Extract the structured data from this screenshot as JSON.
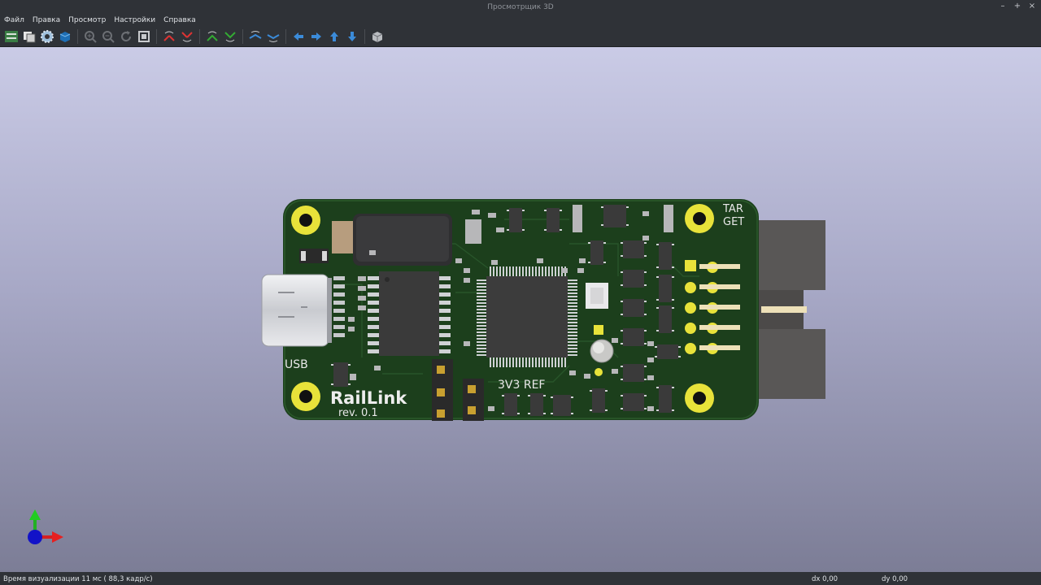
{
  "window": {
    "title": "Просмотрщик 3D"
  },
  "menu": [
    "Файл",
    "Правка",
    "Просмотр",
    "Настройки",
    "Справка"
  ],
  "toolbar_icons": [
    "reload-board-icon",
    "copy-image-icon",
    "raytrace-settings-icon",
    "render-mode-icon",
    "zoom-in-icon",
    "zoom-out-icon",
    "redraw-icon",
    "zoom-fit-icon",
    "rotate-x-cw-icon",
    "rotate-x-ccw-icon",
    "rotate-y-cw-icon",
    "rotate-y-ccw-icon",
    "rotate-z-cw-icon",
    "rotate-z-ccw-icon",
    "move-left-icon",
    "move-right-icon",
    "move-up-icon",
    "move-down-icon",
    "orthographic-icon"
  ],
  "board": {
    "name": "RailLink",
    "revision": "rev. 0.1",
    "label_usb": "USB",
    "label_target_1": "TAR",
    "label_target_2": "GET",
    "label_ref": "3V3 REF",
    "colors": {
      "soldermask": "#1c3f1c",
      "pad": "#e8e23a",
      "background_top": "#cacbe6",
      "background_bottom": "#7c7d96"
    }
  },
  "status": {
    "render_time": "Время визуализации 11 мс ( 88,3 кадр/с)",
    "dx": "dx 0,00",
    "dy": "dy 0,00"
  }
}
